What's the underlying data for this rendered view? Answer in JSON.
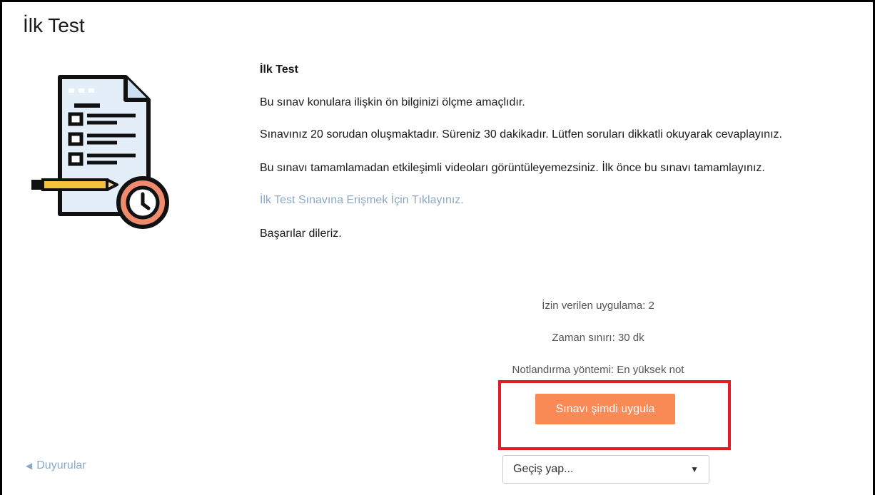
{
  "page": {
    "title": "İlk Test"
  },
  "intro": {
    "title": "İlk Test",
    "paragraph1": "Bu sınav konulara ilişkin ön bilginizi ölçme amaçlıdır.",
    "paragraph2": "Sınavınız 20 sorudan oluşmaktadır. Süreniz 30 dakikadır. Lütfen soruları dikkatli okuyarak cevaplayınız.",
    "paragraph3": "Bu sınavı tamamlamadan etkileşimli videoları görüntüleyemezsiniz. İlk önce bu sınavı tamamlayınız.",
    "link_text": "İlk Test Sınavına Erişmek İçin Tıklayınız.",
    "closing": "Başarılar dileriz."
  },
  "quiz_info": {
    "attempts": "İzin verilen uygulama: 2",
    "time_limit": "Zaman sınırı: 30 dk",
    "grading": "Notlandırma yöntemi: En yüksek not"
  },
  "actions": {
    "start_label": "Sınavı şimdi uygula"
  },
  "navigation": {
    "prev_label": "Duyurular",
    "prev_icon": "triangle-left-icon",
    "jump_placeholder": "Geçiş yap...",
    "jump_icon": "caret-down-icon"
  },
  "colors": {
    "accent_button": "#f98a56",
    "link": "#8aa9c4",
    "highlight": "#e21b26"
  }
}
